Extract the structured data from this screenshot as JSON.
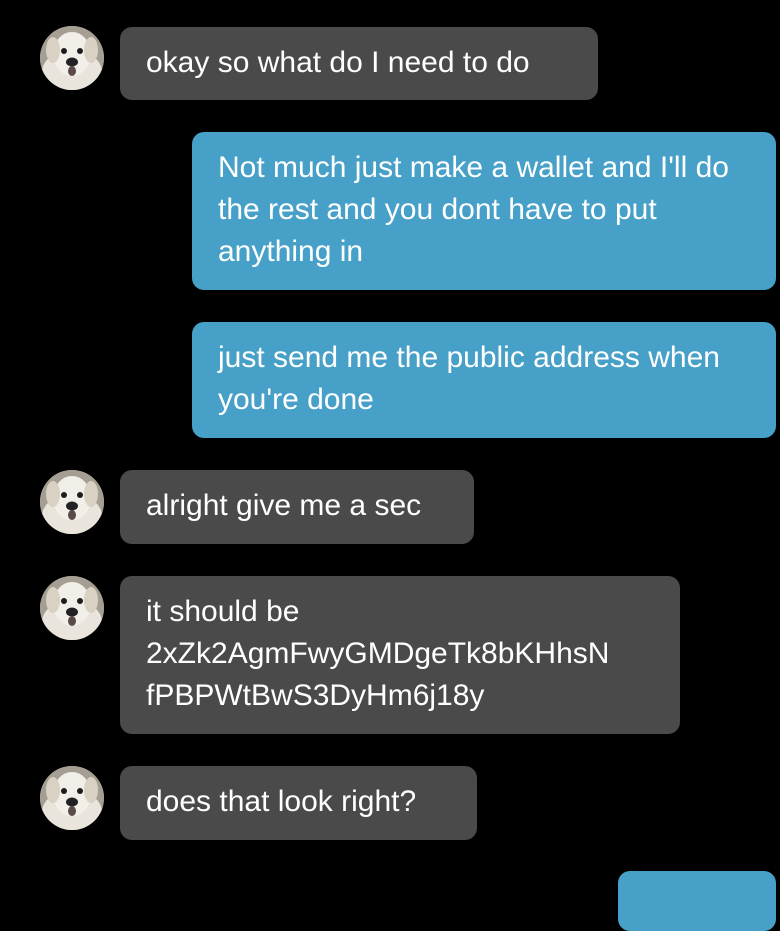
{
  "conversation": {
    "messages": [
      {
        "sender": "them",
        "text": "okay so what do I need to do"
      },
      {
        "sender": "me",
        "text": "Not much just make a wallet and I'll do the rest and you dont have to put anything in"
      },
      {
        "sender": "me",
        "text": "just send me the public address when you're done"
      },
      {
        "sender": "them",
        "text": "alright give me a sec"
      },
      {
        "sender": "them",
        "text": "it should be 2xZk2AgmFwyGMDgeTk8bKHhsN fPBPWtBwS3DyHm6j18y"
      },
      {
        "sender": "them",
        "text": "does that look right?"
      },
      {
        "sender": "me",
        "text": ""
      }
    ]
  },
  "colors": {
    "background": "#000000",
    "incoming_bubble": "#4a4a4a",
    "outgoing_bubble": "#47a0c8",
    "text": "#ffffff"
  },
  "icons": {
    "avatar": "dog-face-avatar"
  }
}
